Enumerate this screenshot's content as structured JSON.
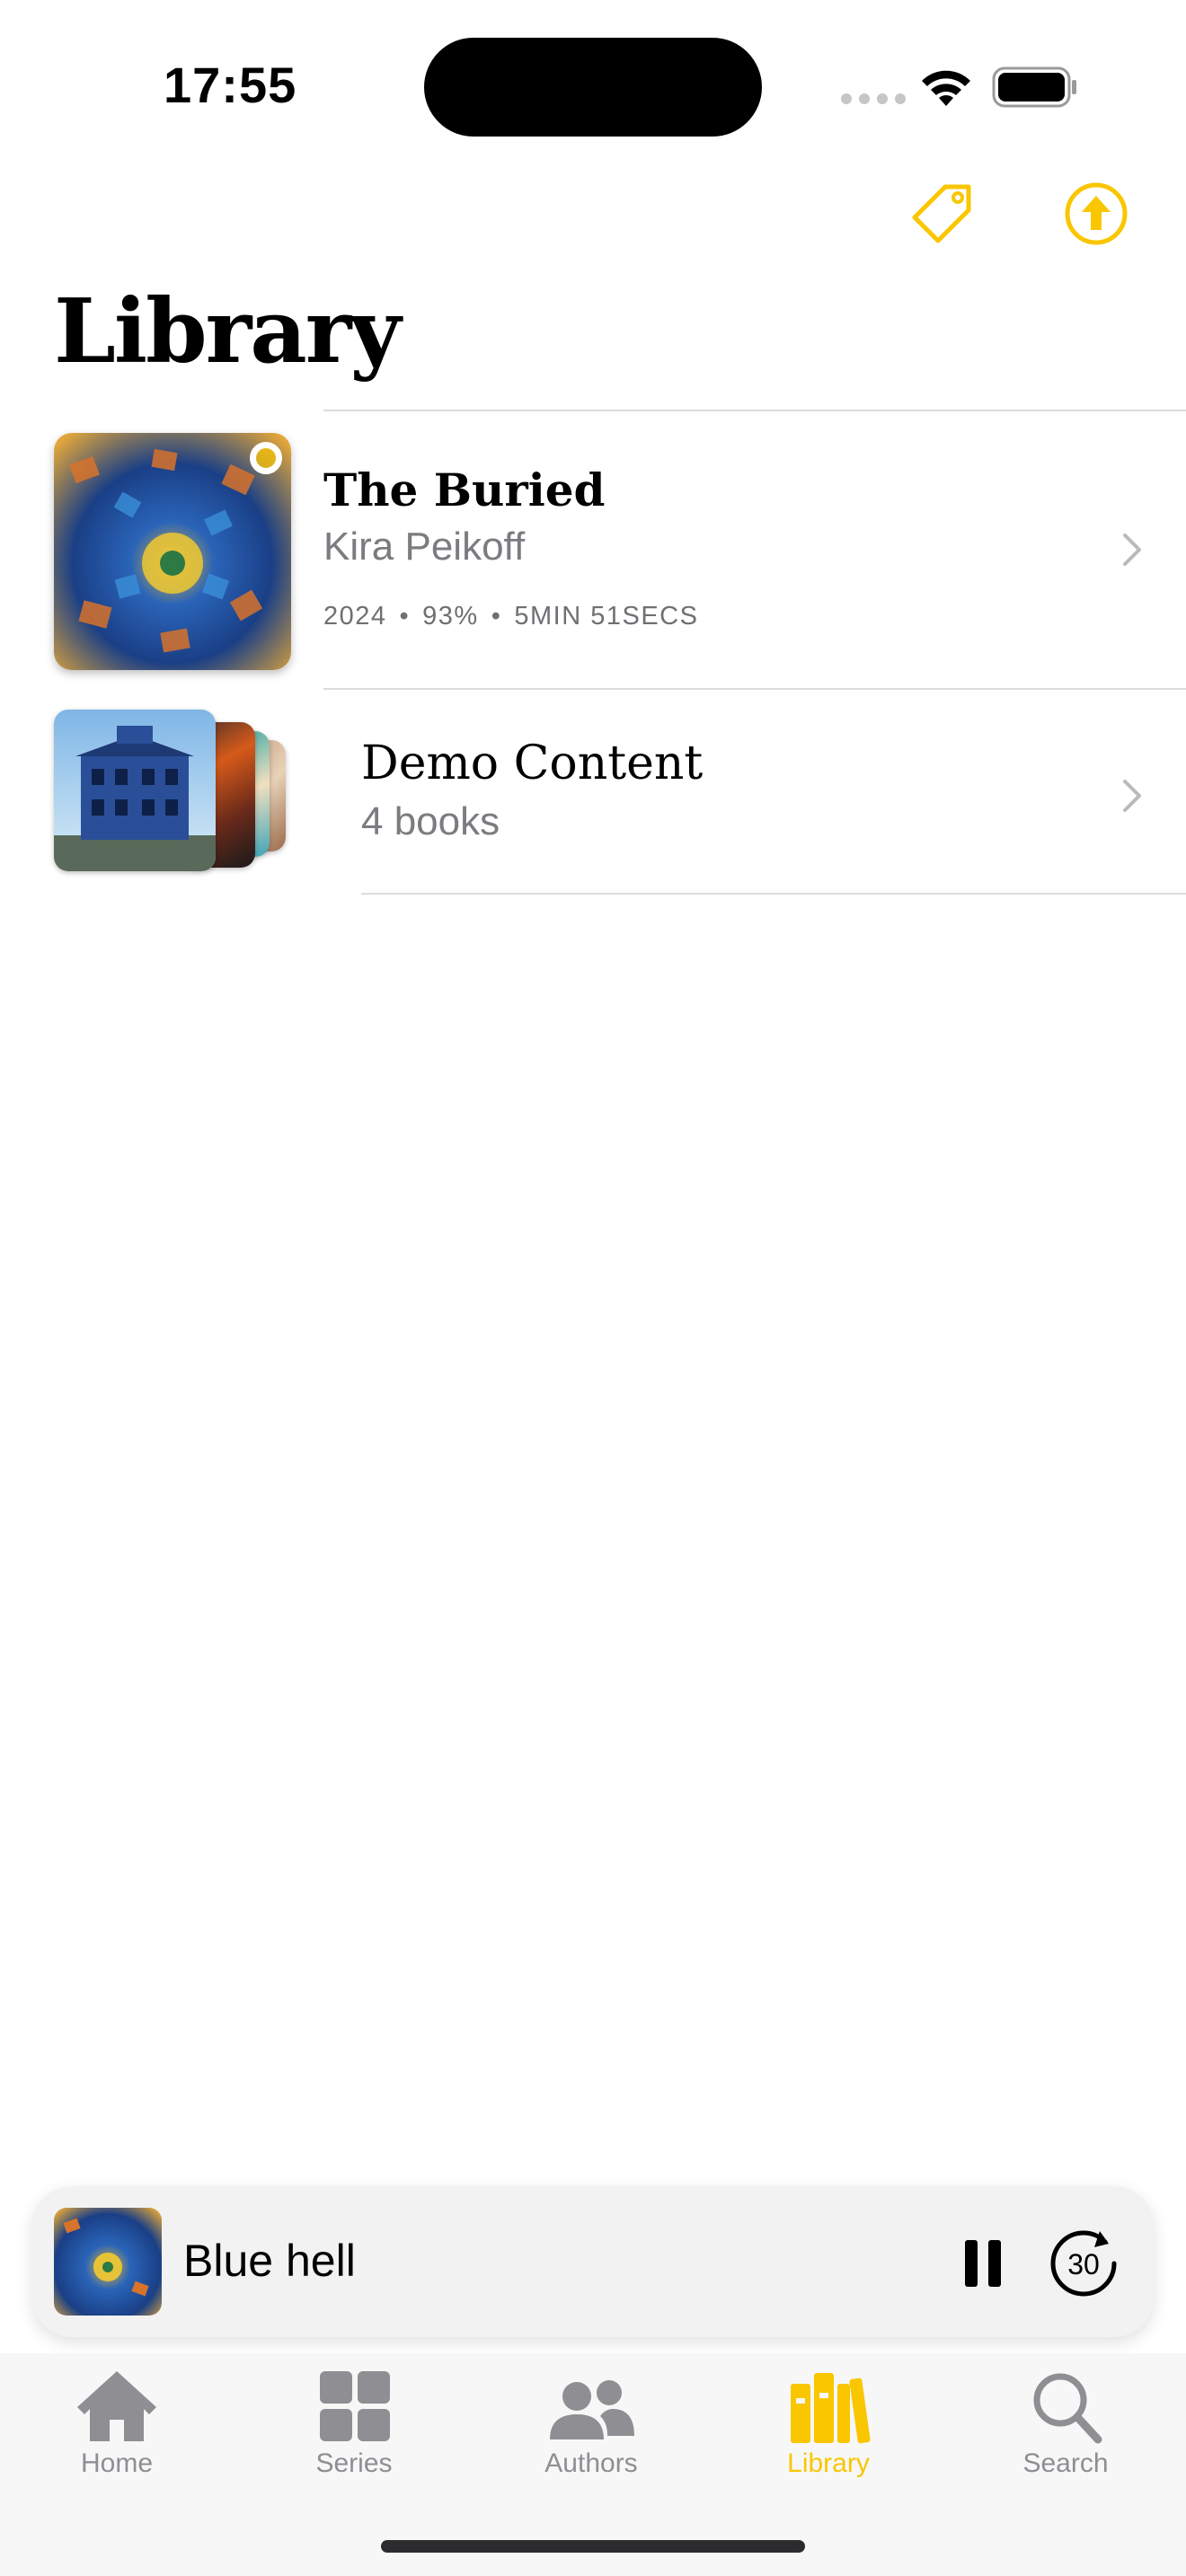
{
  "status_bar": {
    "time": "17:55"
  },
  "page": {
    "title": "Library"
  },
  "items": [
    {
      "title": "The Buried",
      "author": "Kira Peikoff",
      "meta": [
        "2024",
        "•",
        "93%",
        "•",
        "5MIN 51SECS"
      ]
    },
    {
      "title": "Demo Content",
      "subtitle": "4 books"
    }
  ],
  "mini_player": {
    "title": "Blue hell"
  },
  "tabs": [
    {
      "label": "Home",
      "icon": "house-icon"
    },
    {
      "label": "Series",
      "icon": "grid-icon"
    },
    {
      "label": "Authors",
      "icon": "people-icon"
    },
    {
      "label": "Library",
      "icon": "books-icon",
      "active": true
    },
    {
      "label": "Search",
      "icon": "magnifier-icon"
    }
  ],
  "colors": {
    "accent": "#f9c600",
    "secondary_text": "#7b7b80",
    "separator": "#dcdcdf"
  }
}
